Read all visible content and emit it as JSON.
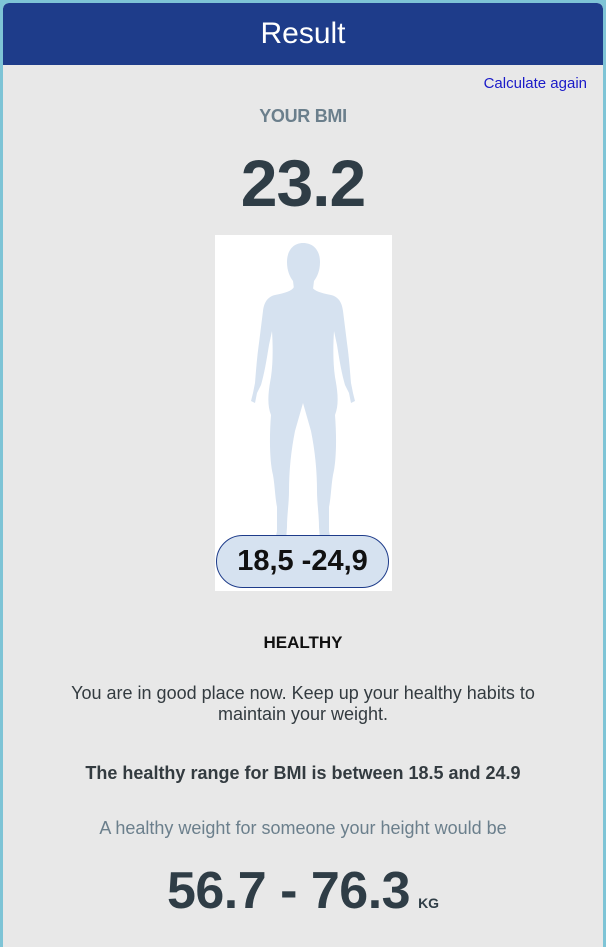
{
  "header": {
    "title": "Result"
  },
  "actions": {
    "calculate_again": "Calculate again"
  },
  "bmi": {
    "label": "YOUR BMI",
    "value": "23.2",
    "range_badge": "18,5 -24,9",
    "status": "HEALTHY"
  },
  "message": "You are in good place now. Keep up your healthy habits to maintain your weight.",
  "healthy_range_text": "The healthy range for BMI is between 18.5 and 24.9",
  "weight": {
    "intro": "A healthy weight for someone your height would be",
    "range": "56.7 - 76.3",
    "unit": "KG"
  },
  "colors": {
    "header_bg": "#1e3c8a",
    "card_bg": "#e8e8e8",
    "link": "#1a1ac8",
    "figure": "#d6e2f0"
  },
  "icons": {
    "body_figure": "human-silhouette-icon"
  }
}
